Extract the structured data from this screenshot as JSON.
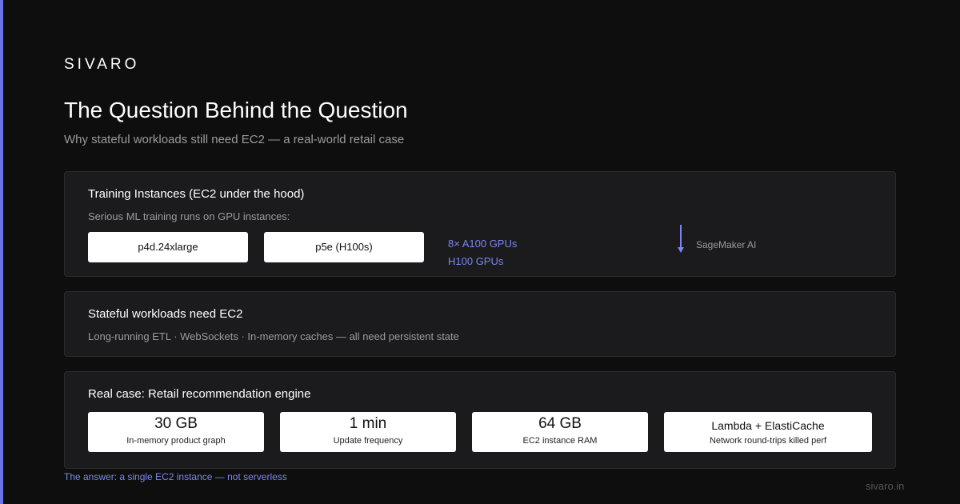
{
  "brand": {
    "logo_text": "SIVARO",
    "accent_color": "#6b74e8",
    "footer_url": "sivaro.in"
  },
  "header": {
    "title": "The Question Behind the Question",
    "subtitle": "Why stateful workloads still need EC2 — a real-world retail case"
  },
  "training": {
    "title": "Training Instances (EC2 under the hood)",
    "description": "Serious ML training runs on GPU instances:",
    "instances": [
      {
        "label": "p4d.24xlarge"
      },
      {
        "label": "p5e (H100s)"
      }
    ],
    "gpu_notes": [
      "8× A100 GPUs",
      "H100 GPUs"
    ],
    "arrow_icon": "arrow-down-icon",
    "service_label": "SageMaker AI"
  },
  "stateful": {
    "title": "Stateful workloads need EC2",
    "description": "Long-running ETL · WebSockets · In-memory caches — all need persistent state"
  },
  "retail_case": {
    "title": "Real case: Retail recommendation engine",
    "stats": [
      {
        "value": "30 GB",
        "label": "In-memory product graph"
      },
      {
        "value": "1 min",
        "label": "Update frequency"
      },
      {
        "value": "64 GB",
        "label": "EC2 instance RAM"
      },
      {
        "value": "Lambda + ElastiCache",
        "label": "Network round-trips killed perf"
      }
    ]
  },
  "answer": "The answer: a single EC2 instance — not serverless"
}
